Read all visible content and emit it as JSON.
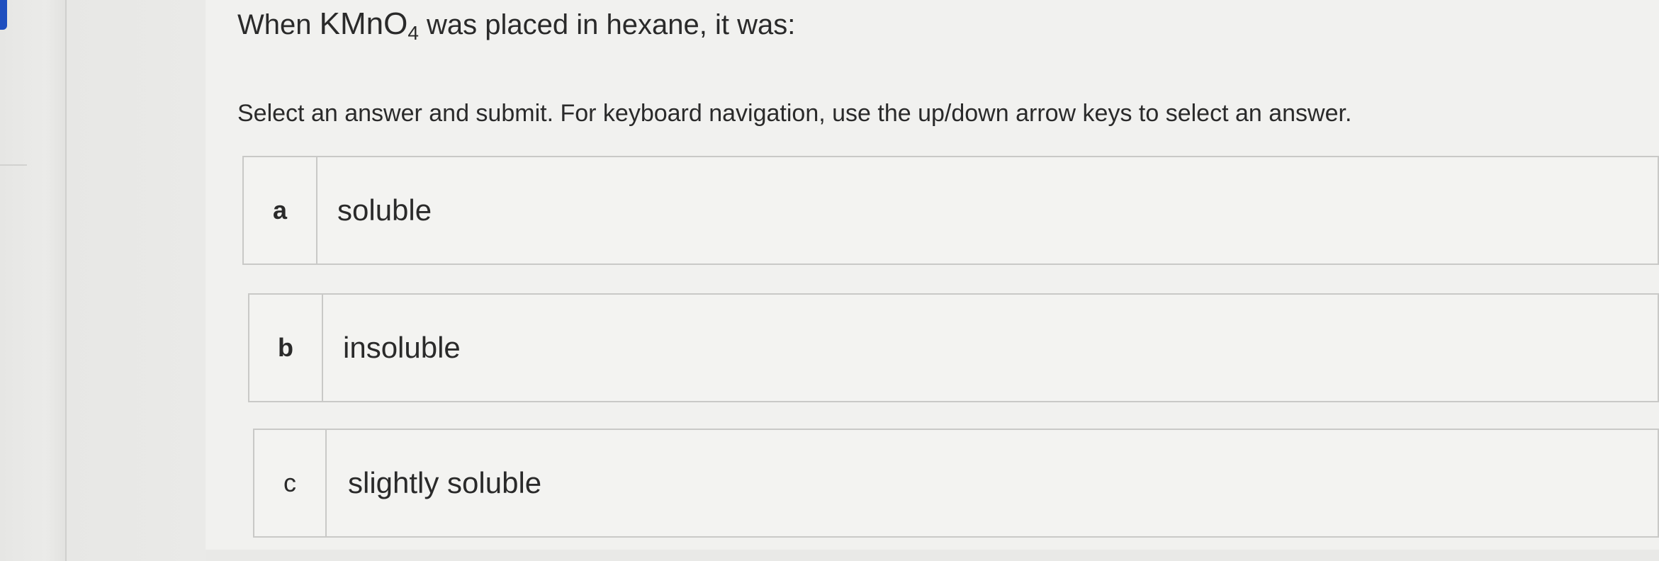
{
  "question": {
    "prefix": "When",
    "formula_main": "KMnO",
    "formula_sub": "4",
    "suffix": "was placed in hexane, it was:"
  },
  "instructions": "Select an answer and submit. For keyboard navigation, use the up/down arrow keys to select an answer.",
  "options": [
    {
      "letter": "a",
      "text": "soluble"
    },
    {
      "letter": "b",
      "text": "insoluble"
    },
    {
      "letter": "c",
      "text": "slightly soluble"
    }
  ],
  "colors": {
    "accent": "#1f4fbf",
    "border": "#c9c9c7",
    "panel": "#f1f1ef"
  }
}
